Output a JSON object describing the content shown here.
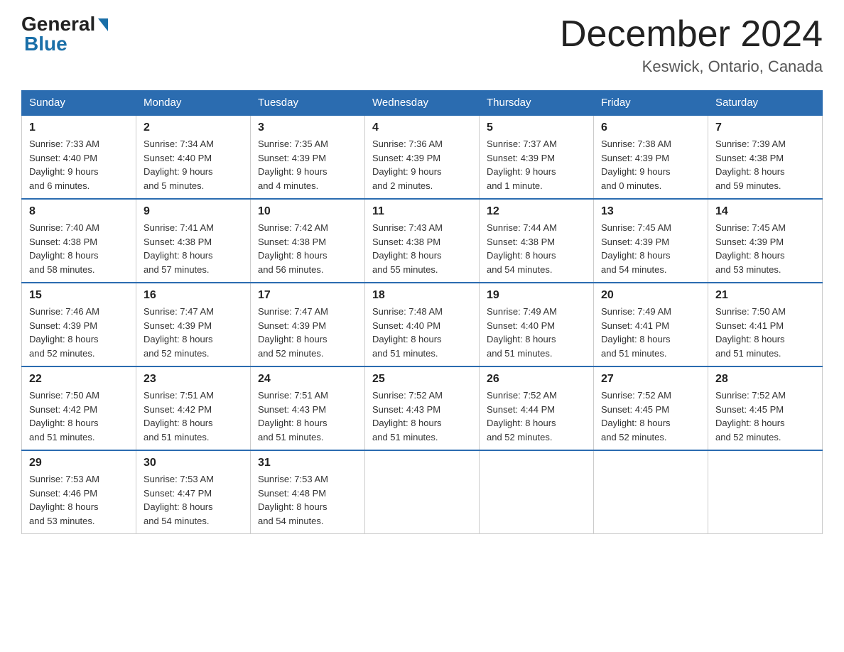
{
  "logo": {
    "text_general": "General",
    "text_blue": "Blue"
  },
  "title": "December 2024",
  "location": "Keswick, Ontario, Canada",
  "days_of_week": [
    "Sunday",
    "Monday",
    "Tuesday",
    "Wednesday",
    "Thursday",
    "Friday",
    "Saturday"
  ],
  "weeks": [
    [
      {
        "day": "1",
        "sunrise": "7:33 AM",
        "sunset": "4:40 PM",
        "daylight": "9 hours and 6 minutes."
      },
      {
        "day": "2",
        "sunrise": "7:34 AM",
        "sunset": "4:40 PM",
        "daylight": "9 hours and 5 minutes."
      },
      {
        "day": "3",
        "sunrise": "7:35 AM",
        "sunset": "4:39 PM",
        "daylight": "9 hours and 4 minutes."
      },
      {
        "day": "4",
        "sunrise": "7:36 AM",
        "sunset": "4:39 PM",
        "daylight": "9 hours and 2 minutes."
      },
      {
        "day": "5",
        "sunrise": "7:37 AM",
        "sunset": "4:39 PM",
        "daylight": "9 hours and 1 minute."
      },
      {
        "day": "6",
        "sunrise": "7:38 AM",
        "sunset": "4:39 PM",
        "daylight": "9 hours and 0 minutes."
      },
      {
        "day": "7",
        "sunrise": "7:39 AM",
        "sunset": "4:38 PM",
        "daylight": "8 hours and 59 minutes."
      }
    ],
    [
      {
        "day": "8",
        "sunrise": "7:40 AM",
        "sunset": "4:38 PM",
        "daylight": "8 hours and 58 minutes."
      },
      {
        "day": "9",
        "sunrise": "7:41 AM",
        "sunset": "4:38 PM",
        "daylight": "8 hours and 57 minutes."
      },
      {
        "day": "10",
        "sunrise": "7:42 AM",
        "sunset": "4:38 PM",
        "daylight": "8 hours and 56 minutes."
      },
      {
        "day": "11",
        "sunrise": "7:43 AM",
        "sunset": "4:38 PM",
        "daylight": "8 hours and 55 minutes."
      },
      {
        "day": "12",
        "sunrise": "7:44 AM",
        "sunset": "4:38 PM",
        "daylight": "8 hours and 54 minutes."
      },
      {
        "day": "13",
        "sunrise": "7:45 AM",
        "sunset": "4:39 PM",
        "daylight": "8 hours and 54 minutes."
      },
      {
        "day": "14",
        "sunrise": "7:45 AM",
        "sunset": "4:39 PM",
        "daylight": "8 hours and 53 minutes."
      }
    ],
    [
      {
        "day": "15",
        "sunrise": "7:46 AM",
        "sunset": "4:39 PM",
        "daylight": "8 hours and 52 minutes."
      },
      {
        "day": "16",
        "sunrise": "7:47 AM",
        "sunset": "4:39 PM",
        "daylight": "8 hours and 52 minutes."
      },
      {
        "day": "17",
        "sunrise": "7:47 AM",
        "sunset": "4:39 PM",
        "daylight": "8 hours and 52 minutes."
      },
      {
        "day": "18",
        "sunrise": "7:48 AM",
        "sunset": "4:40 PM",
        "daylight": "8 hours and 51 minutes."
      },
      {
        "day": "19",
        "sunrise": "7:49 AM",
        "sunset": "4:40 PM",
        "daylight": "8 hours and 51 minutes."
      },
      {
        "day": "20",
        "sunrise": "7:49 AM",
        "sunset": "4:41 PM",
        "daylight": "8 hours and 51 minutes."
      },
      {
        "day": "21",
        "sunrise": "7:50 AM",
        "sunset": "4:41 PM",
        "daylight": "8 hours and 51 minutes."
      }
    ],
    [
      {
        "day": "22",
        "sunrise": "7:50 AM",
        "sunset": "4:42 PM",
        "daylight": "8 hours and 51 minutes."
      },
      {
        "day": "23",
        "sunrise": "7:51 AM",
        "sunset": "4:42 PM",
        "daylight": "8 hours and 51 minutes."
      },
      {
        "day": "24",
        "sunrise": "7:51 AM",
        "sunset": "4:43 PM",
        "daylight": "8 hours and 51 minutes."
      },
      {
        "day": "25",
        "sunrise": "7:52 AM",
        "sunset": "4:43 PM",
        "daylight": "8 hours and 51 minutes."
      },
      {
        "day": "26",
        "sunrise": "7:52 AM",
        "sunset": "4:44 PM",
        "daylight": "8 hours and 52 minutes."
      },
      {
        "day": "27",
        "sunrise": "7:52 AM",
        "sunset": "4:45 PM",
        "daylight": "8 hours and 52 minutes."
      },
      {
        "day": "28",
        "sunrise": "7:52 AM",
        "sunset": "4:45 PM",
        "daylight": "8 hours and 52 minutes."
      }
    ],
    [
      {
        "day": "29",
        "sunrise": "7:53 AM",
        "sunset": "4:46 PM",
        "daylight": "8 hours and 53 minutes."
      },
      {
        "day": "30",
        "sunrise": "7:53 AM",
        "sunset": "4:47 PM",
        "daylight": "8 hours and 54 minutes."
      },
      {
        "day": "31",
        "sunrise": "7:53 AM",
        "sunset": "4:48 PM",
        "daylight": "8 hours and 54 minutes."
      },
      null,
      null,
      null,
      null
    ]
  ],
  "labels": {
    "sunrise_prefix": "Sunrise: ",
    "sunset_prefix": "Sunset: ",
    "daylight_prefix": "Daylight: "
  }
}
